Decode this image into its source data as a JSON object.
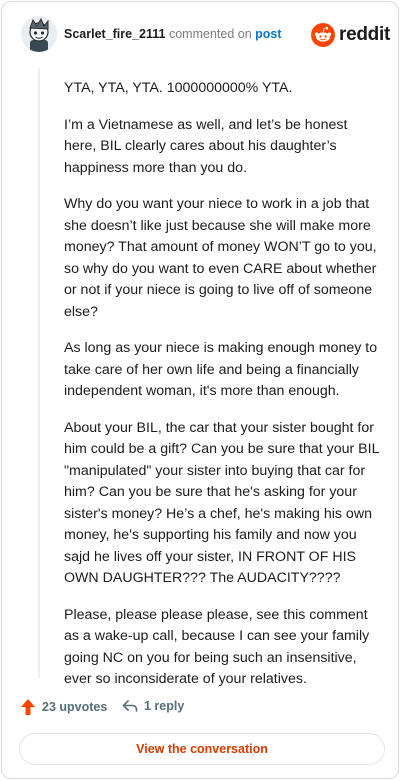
{
  "header": {
    "username": "Scarlet_fire_2111",
    "action_text": "commented on",
    "post_link": "post",
    "logo_text": "reddit",
    "avatar_icon": "snoo-avatar-icon"
  },
  "comment": {
    "paragraphs": [
      "YTA, YTA, YTA. 1000000000% YTA.",
      "I’m a Vietnamese as well, and let’s be honest here, BIL clearly cares about his daughter’s happiness more than you do.",
      "Why do you want your niece to work in a job that she doesn’t like just because she will make more money? That amount of money WON’T go to you, so why do you want to even CARE about whether or not if your niece is going to live off of someone else?",
      "As long as your niece is making enough money to take care of her own life and being a financially independent woman, it's more than enough.",
      "About your BIL, the car that your sister bought for him could be a gift? Can you be sure that your BIL \"manipulated\" your sister into buying that car for him? Can you be sure that he's asking for your sister's money? He’s a chef, he's making his own money, he's supporting his family and now you sajd he lives off your sister, IN FRONT OF HIS OWN DAUGHTER??? The AUDACITY????",
      "Please, please please please, see this comment as a wake-up call, because I can see your family going NC on you for being such an insensitive, ever so inconsiderate of your relatives."
    ]
  },
  "footer": {
    "upvotes": "23 upvotes",
    "replies": "1 reply",
    "view_button": "View the conversation"
  },
  "colors": {
    "accent": "#ff4500",
    "link": "#0079d3",
    "button_text": "#d93a00",
    "muted": "#576f76"
  }
}
